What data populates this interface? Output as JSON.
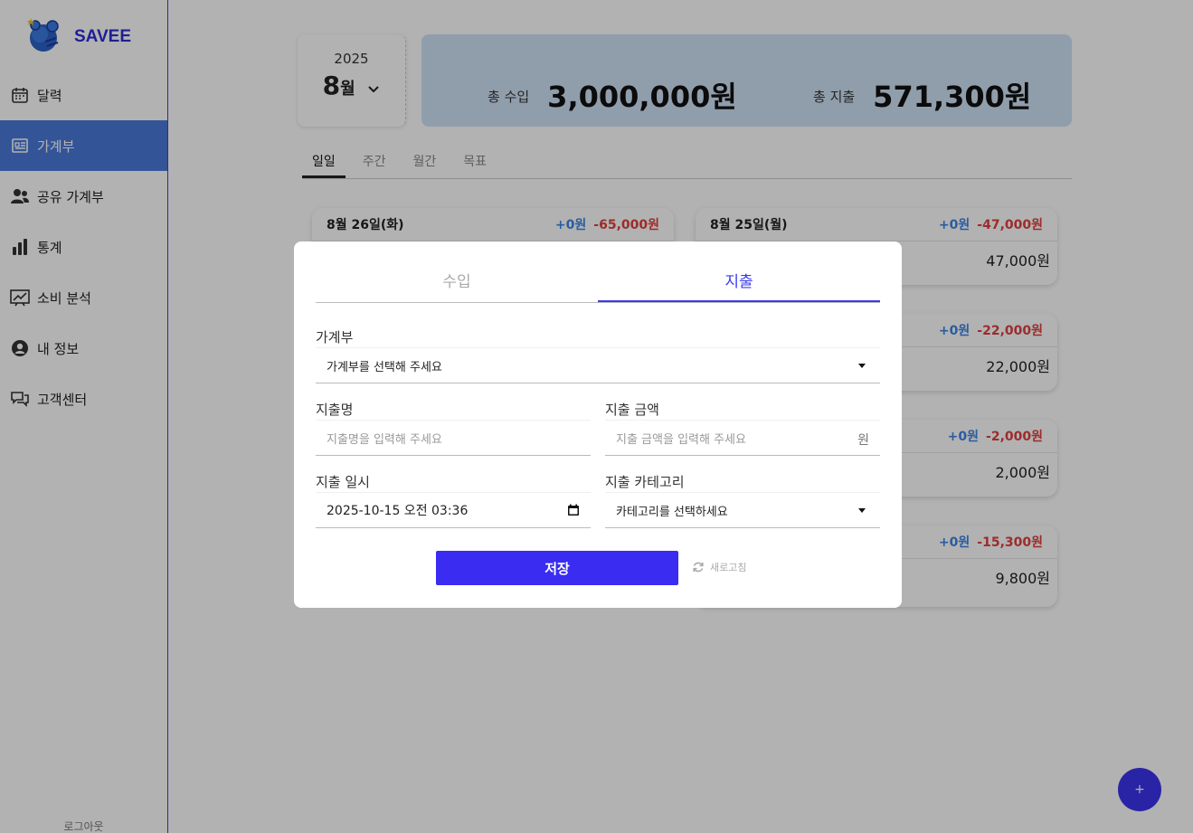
{
  "app": {
    "name": "SAVEE"
  },
  "sidebar": {
    "items": [
      {
        "label": "달력",
        "icon": "calendar-icon"
      },
      {
        "label": "가계부",
        "icon": "ledger-icon",
        "active": true
      },
      {
        "label": "공유 가계부",
        "icon": "users-icon"
      },
      {
        "label": "통계",
        "icon": "bar-chart-icon"
      },
      {
        "label": "소비 분석",
        "icon": "trend-chart-icon"
      },
      {
        "label": "내 정보",
        "icon": "user-icon"
      },
      {
        "label": "고객센터",
        "icon": "chat-icon"
      }
    ],
    "logout": "로그아웃"
  },
  "summary": {
    "year": "2025",
    "month": "8",
    "month_unit": "월",
    "income_label": "총 수입",
    "income_value": "3,000,000원",
    "expense_label": "총 지출",
    "expense_value": "571,300원"
  },
  "view_tabs": [
    "일일",
    "주간",
    "월간",
    "목표"
  ],
  "cards": [
    {
      "date": "8월 26일(화)",
      "income": "+0원",
      "expense": "-65,000원",
      "amount": ""
    },
    {
      "date": "8월 25일(월)",
      "income": "+0원",
      "expense": "-47,000원",
      "amount": "47,000원"
    },
    {
      "date": "",
      "income": "+0원",
      "expense": "-22,000원",
      "amount": "22,000원"
    },
    {
      "date": "",
      "income": "+0원",
      "expense": "-2,000원",
      "amount": "2,000원"
    },
    {
      "date": "",
      "income": "+0원",
      "expense": "-15,300원",
      "amount": "9,800원"
    }
  ],
  "fab": {
    "label": "+"
  },
  "modal": {
    "tabs": [
      "수입",
      "지출"
    ],
    "active_tab": "지출",
    "ledger": {
      "label": "가계부",
      "value": "가계부를 선택해 주세요"
    },
    "name": {
      "label": "지출명",
      "placeholder": "지출명을 입력해 주세요"
    },
    "amount": {
      "label": "지출 금액",
      "placeholder": "지출 금액을 입력해 주세요",
      "unit": "원"
    },
    "datetime": {
      "label": "지출 일시",
      "value": "2025-10-15 오전 03:36"
    },
    "category": {
      "label": "지출 카테고리",
      "value": "카테고리를 선택하세요"
    },
    "save_label": "저장",
    "refresh_label": "새로고침"
  },
  "colors": {
    "accent": "#3b34ee",
    "active_nav": "#4a7ad8",
    "income": "#3d84e6",
    "expense": "#e0403f",
    "summary_bg": "#cfe3f6"
  }
}
